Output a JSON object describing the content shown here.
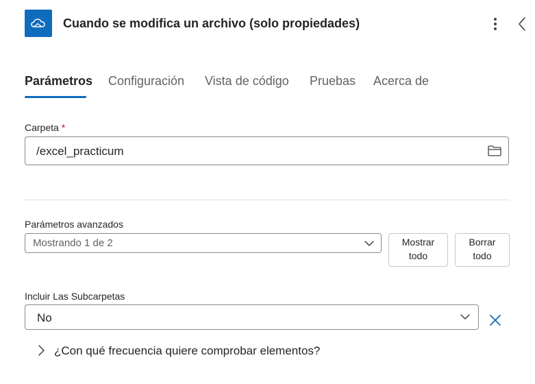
{
  "header": {
    "app_icon": "onedrive-cloud-icon",
    "title": "Cuando se modifica un archivo (solo propiedades)",
    "more_icon": "more-vertical-icon",
    "collapse_icon": "chevron-left-icon"
  },
  "tabs": [
    {
      "label": "Parámetros",
      "active": true
    },
    {
      "label": "Configuración",
      "active": false
    },
    {
      "label": "Vista de código",
      "active": false
    },
    {
      "label": "Pruebas",
      "active": false
    },
    {
      "label": "Acerca de",
      "active": false
    }
  ],
  "folder": {
    "label": "Carpeta",
    "required_mark": "*",
    "value": "/excel_practicum",
    "icon": "folder-icon"
  },
  "advanced": {
    "label": "Parámetros avanzados",
    "value": "Mostrando 1 de 2",
    "show_all_line1": "Mostrar",
    "show_all_line2": "todo",
    "clear_all_line1": "Borrar",
    "clear_all_line2": "todo"
  },
  "subfolders": {
    "label": "Incluir Las Subcarpetas",
    "value": "No",
    "remove_icon": "close-icon"
  },
  "frequency": {
    "question": "¿Con qué frecuencia quiere comprobar elementos?",
    "icon": "chevron-right-icon"
  },
  "colors": {
    "accent": "#0f6cbd",
    "required": "#c50f1f"
  }
}
